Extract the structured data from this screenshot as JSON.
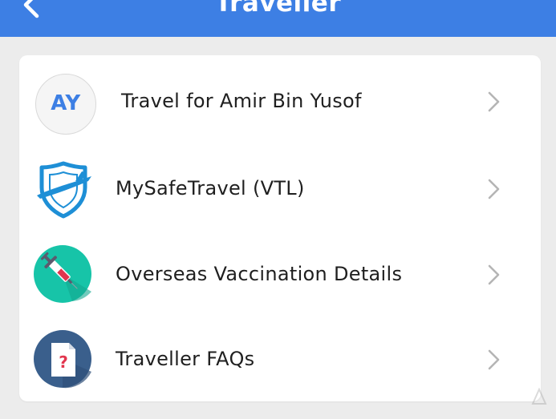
{
  "header": {
    "title": "Traveller",
    "back_icon": "chevron-left-icon"
  },
  "colors": {
    "header_bg": "#3d7fe4",
    "page_bg": "#ececec",
    "card_bg": "#ffffff",
    "avatar_text": "#3d7fe4",
    "chevron": "#b5b5b5"
  },
  "menu": {
    "items": [
      {
        "avatar_initials": "AY",
        "label": "Travel for Amir Bin Yusof",
        "icon": "avatar-icon"
      },
      {
        "label": "MySafeTravel (VTL)",
        "icon": "shield-plane-icon"
      },
      {
        "label": "Overseas Vaccination Details",
        "icon": "syringe-icon"
      },
      {
        "label": "Traveller FAQs",
        "icon": "faq-document-icon"
      }
    ]
  }
}
